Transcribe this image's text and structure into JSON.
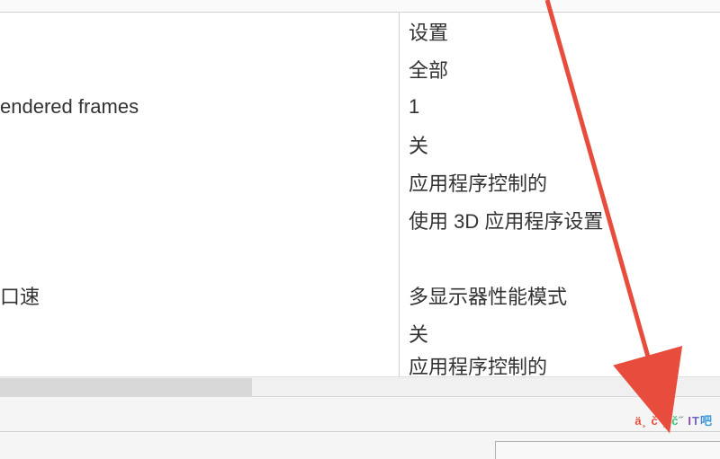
{
  "table": {
    "left": [
      "",
      "",
      "endered frames",
      "",
      "",
      "",
      "",
      "口速",
      "",
      ""
    ],
    "right": [
      "设置",
      "全部",
      "1",
      "关",
      "应用程序控制的",
      "使用 3D 应用程序设置",
      "",
      "多显示器性能模式",
      "关",
      "应用程序控制的"
    ]
  },
  "watermark": "ä¸ č ¸ č˝ IT吧",
  "colors": {
    "arrow": "#e74c3c",
    "border": "#d0d0d0",
    "panel": "#f5f5f5"
  }
}
